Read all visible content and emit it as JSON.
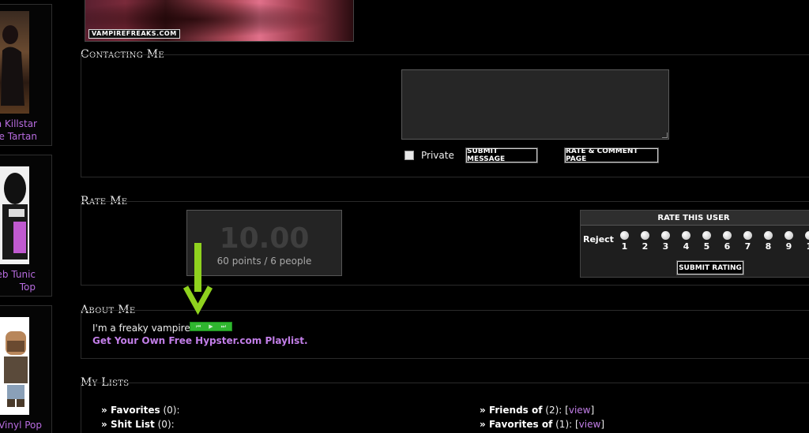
{
  "products": [
    {
      "label_lines": [
        "n Killstar",
        "e Tartan"
      ]
    },
    {
      "label_lines": [
        "eb Tunic",
        "Top"
      ]
    },
    {
      "label_lines": [
        "Vinyl Pop"
      ]
    }
  ],
  "photo": {
    "logo": "VAMPIREFREAKS.COM"
  },
  "contact": {
    "title": "Contacting Me",
    "private_label": "Private",
    "submit_label": "SUBMIT MESSAGE",
    "rate_comment_label": "RATE & COMMENT PAGE"
  },
  "rate": {
    "title": "Rate Me",
    "score": "10.00",
    "score_sub": "60 points / 6 people",
    "widget_title": "RATE THIS USER",
    "reject_label": "Reject",
    "options": [
      "1",
      "2",
      "3",
      "4",
      "5",
      "6",
      "7",
      "8",
      "9",
      "1"
    ],
    "submit_label": "SUBMIT RATING"
  },
  "about": {
    "title": "About Me",
    "text": "I'm a freaky vampire.",
    "playlist_link": "Get Your Own Free Hypster.com Playlist."
  },
  "lists": {
    "title": "My Lists",
    "items": [
      {
        "label": "Favorites",
        "count": "(0):",
        "link": ""
      },
      {
        "label": "Shit List",
        "count": "(0):",
        "link": ""
      },
      {
        "label": "Friends of",
        "count": "(2): [",
        "link": "view",
        "tail": "]"
      },
      {
        "label": "Favorites of",
        "count": "(1): [",
        "link": "view",
        "tail": "]"
      }
    ]
  },
  "colors": {
    "accent_link": "#c27ee8",
    "player_green": "#2fb62f",
    "arrow_green": "#8fd21e"
  }
}
